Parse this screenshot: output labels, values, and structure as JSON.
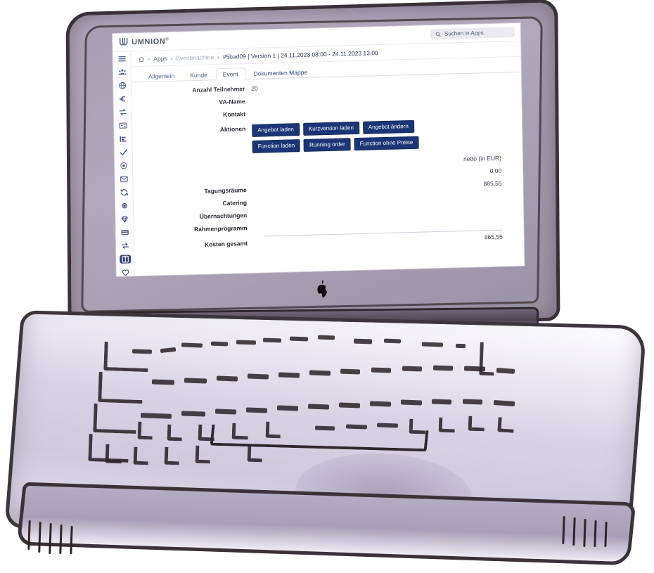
{
  "app": {
    "brand_name": "UMNION",
    "brand_reg": "®",
    "logo_icon": "umnion-u-logo"
  },
  "search": {
    "placeholder": "Suchen in Apps",
    "icon": "search-icon"
  },
  "breadcrumb": {
    "home_icon": "home-icon",
    "separator": "›",
    "items": [
      {
        "label": "Apps",
        "state": "link"
      },
      {
        "label": "Eventmachine",
        "state": "muted"
      },
      {
        "label": "#5bad09 | Version 1 | 24.11.2023 08:00 - 24.11.2023 13:00",
        "state": "current"
      }
    ]
  },
  "sidebar": {
    "items": [
      {
        "icon": "hamburger-menu-icon",
        "name": "menu",
        "active": false
      },
      {
        "icon": "people-group-icon",
        "name": "contacts",
        "active": false
      },
      {
        "icon": "globe-icon",
        "name": "globe",
        "active": false
      },
      {
        "icon": "euro-icon",
        "name": "finance",
        "active": false
      },
      {
        "icon": "transfer-arrows-icon",
        "name": "transfer",
        "active": false
      },
      {
        "icon": "id-card-icon",
        "name": "id-card",
        "active": false
      },
      {
        "icon": "bar-chart-icon",
        "name": "reports",
        "active": false
      },
      {
        "icon": "check-icon",
        "name": "tasks",
        "active": false
      },
      {
        "icon": "eye-icon",
        "name": "preview",
        "active": false
      },
      {
        "icon": "mail-icon",
        "name": "mail",
        "active": false
      },
      {
        "icon": "sync-icon",
        "name": "sync",
        "active": false
      },
      {
        "icon": "network-icon",
        "name": "network",
        "active": false
      },
      {
        "icon": "diamond-icon",
        "name": "quality",
        "active": false
      },
      {
        "icon": "card-icon",
        "name": "card",
        "active": false
      },
      {
        "icon": "exchange-icon",
        "name": "exchange",
        "active": false
      },
      {
        "icon": "book-icon",
        "name": "eventmachine",
        "active": true
      },
      {
        "icon": "heart-icon",
        "name": "favorites",
        "active": false
      },
      {
        "icon": "list-icon",
        "name": "list",
        "active": false
      }
    ]
  },
  "tabs": [
    {
      "label": "Allgemein",
      "active": false
    },
    {
      "label": "Kunde",
      "active": false
    },
    {
      "label": "Event",
      "active": true
    },
    {
      "label": "Dokumenten Mappe",
      "active": false
    }
  ],
  "form": {
    "participants_label": "Anzahl Teilnehmer",
    "participants_value": "20",
    "vaname_label": "VA-Name",
    "vaname_value": "",
    "kontakt_label": "Kontakt",
    "kontakt_value": "",
    "aktionen_label": "Aktionen"
  },
  "actions": {
    "buttons": [
      "Angebot laden",
      "Kurzversion laden",
      "Angebot ändern",
      "Function laden",
      "Running order",
      "Function ohne Preise"
    ]
  },
  "costs": {
    "column_header": "netto (in EUR)",
    "rows": [
      {
        "label": "",
        "value": "0,00"
      },
      {
        "label": "Tagungsräume",
        "value": "865,55"
      },
      {
        "label": "Catering",
        "value": ""
      },
      {
        "label": "Übernachtungen",
        "value": ""
      },
      {
        "label": "Rahmenprogramm",
        "value": ""
      }
    ],
    "total_label": "Kosten gesamt",
    "total_value": "865,55"
  },
  "hardware": {
    "device": "sketched-laptop",
    "logo_icon": "apple-logo-icon"
  },
  "colors": {
    "accent": "#1b3576",
    "brand_text": "#2a2f45",
    "link": "#2b3c6e",
    "muted": "#9aa0b4",
    "lid": "#a79eb3",
    "deck": "#d8d3e4",
    "ink": "#2f282e"
  }
}
